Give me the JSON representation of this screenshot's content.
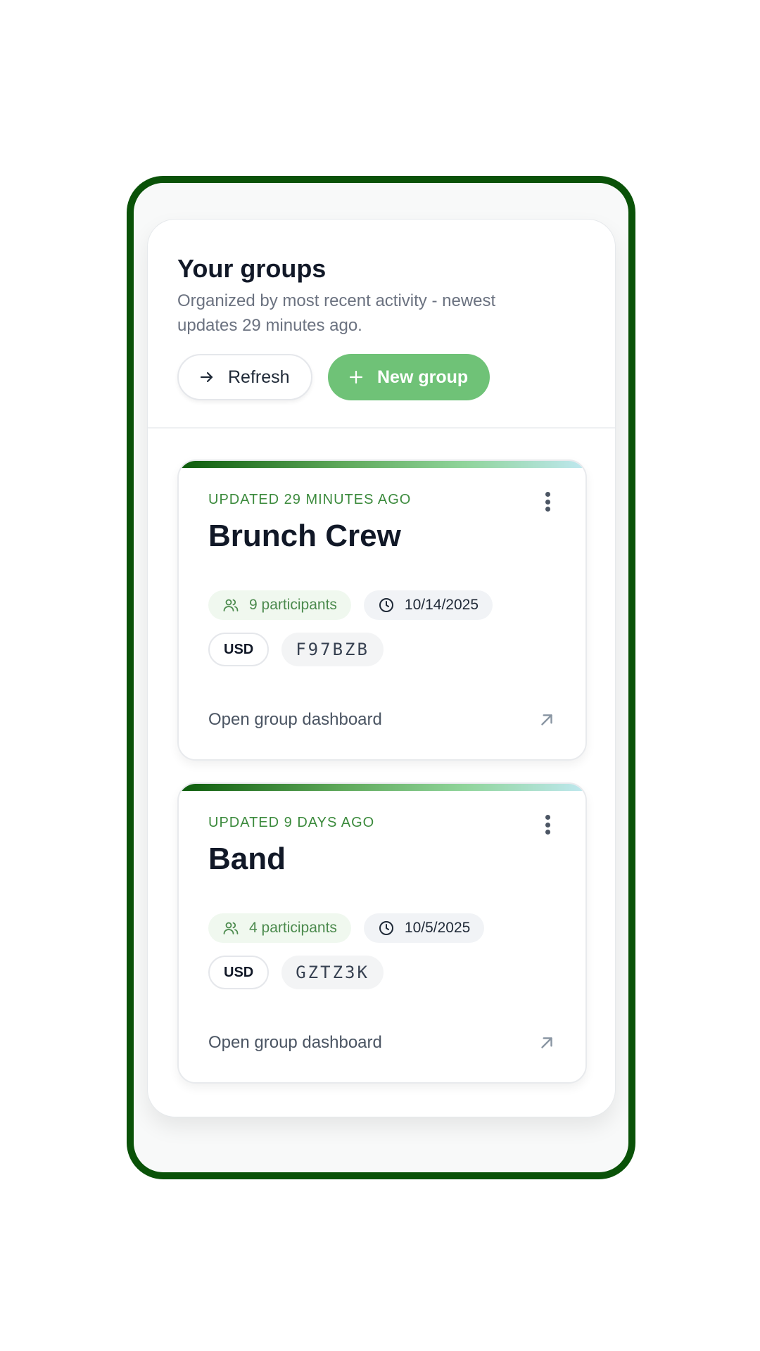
{
  "header": {
    "title": "Your groups",
    "subtitle": "Organized by most recent activity - newest updates 29 minutes ago.",
    "refresh_label": "Refresh",
    "new_group_label": "New group"
  },
  "colors": {
    "frame": "#0a5208",
    "accent_green": "#6fc277",
    "updated_text": "#3b8a3c"
  },
  "groups": [
    {
      "updated": "UPDATED 29 MINUTES AGO",
      "name": "Brunch Crew",
      "participants": "9 participants",
      "date": "10/14/2025",
      "currency": "USD",
      "code": "F97BZB",
      "open_label": "Open group dashboard"
    },
    {
      "updated": "UPDATED 9 DAYS AGO",
      "name": "Band",
      "participants": "4 participants",
      "date": "10/5/2025",
      "currency": "USD",
      "code": "GZTZ3K",
      "open_label": "Open group dashboard"
    }
  ]
}
